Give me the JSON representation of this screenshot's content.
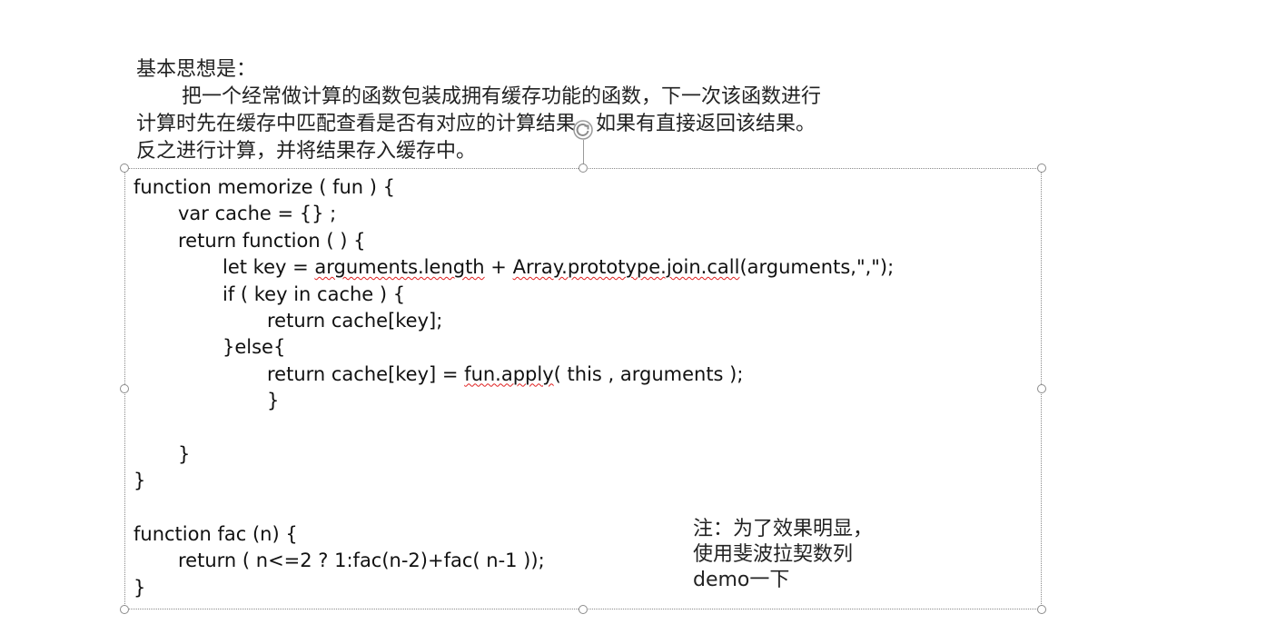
{
  "intro": {
    "heading": "基本思想是：",
    "paragraph_line1": "把一个经常做计算的函数包装成拥有缓存功能的函数，下一次该函数进行",
    "paragraph_line2": "计算时先在缓存中匹配查看是否有对应的计算结果，如果有直接返回该结果。",
    "paragraph_line3": "反之进行计算，并将结果存入缓存中。"
  },
  "code": {
    "l1": "function memorize ( fun ) {",
    "l2": "var cache = {} ;",
    "l3": "return function ( ) {",
    "l4_prefix": "let key = ",
    "l4_word1": "arguments.length",
    "l4_mid": " + ",
    "l4_word2": "Array.prototype.join.call",
    "l4_suffix": "(arguments,\",\");",
    "l5": "if ( key in cache ) {",
    "l6": "return cache[key];",
    "l7": "}else{",
    "l8_prefix": "return cache[key] = ",
    "l8_word": "fun.apply",
    "l8_suffix": "( this , arguments );",
    "l9": "}",
    "l10": "",
    "l11": "}",
    "l12": "}",
    "l13": "",
    "l14": "function fac (n) {",
    "l15": "return ( n<=2 ? 1:fac(n-2)+fac( n-1 ));",
    "l16": "}"
  },
  "note": {
    "line1": "注：为了效果明显，",
    "line2": "使用斐波拉契数列",
    "line3": "demo一下"
  },
  "icons": {
    "rotate": "rotate-handle-icon",
    "resize": "resize-handle-icon"
  },
  "colors": {
    "spellcheck_underline": "#e02020",
    "selection_border": "#8a8a8a",
    "handle": "#8c8c8c"
  }
}
